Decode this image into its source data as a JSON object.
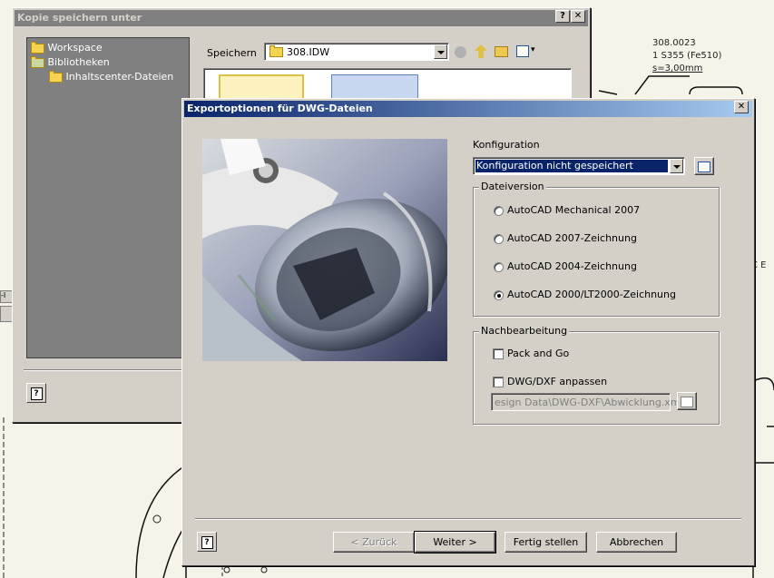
{
  "background": {
    "part_number": "308.0023",
    "material": "1 S355 (Fe510)",
    "thickness": "s=3,00mm",
    "edge_fragment": "C E"
  },
  "save_dialog": {
    "title": "Kopie speichern unter",
    "tree": [
      "Workspace",
      "Bibliotheken",
      "Inhaltscenter-Dateien"
    ],
    "save_in_label": "Speichern",
    "save_in_value": "308.IDW"
  },
  "export_dialog": {
    "title": "Exportoptionen für DWG-Dateien",
    "config_label": "Konfiguration",
    "config_value": "Konfiguration nicht gespeichert",
    "version_group": "Dateiversion",
    "versions": [
      {
        "label": "AutoCAD Mechanical 2007",
        "checked": false
      },
      {
        "label": "AutoCAD 2007-Zeichnung",
        "checked": false
      },
      {
        "label": "AutoCAD 2004-Zeichnung",
        "checked": false
      },
      {
        "label": "AutoCAD 2000/LT2000-Zeichnung",
        "checked": true
      }
    ],
    "post_group": "Nachbearbeitung",
    "pack_and_go": "Pack and Go",
    "dwg_adjust": "DWG/DXF anpassen",
    "xml_path": "esign Data\\DWG-DXF\\Abwicklung.xml",
    "buttons": {
      "back": "< Zurück",
      "next": "Weiter >",
      "finish": "Fertig stellen",
      "cancel": "Abbrechen"
    }
  }
}
